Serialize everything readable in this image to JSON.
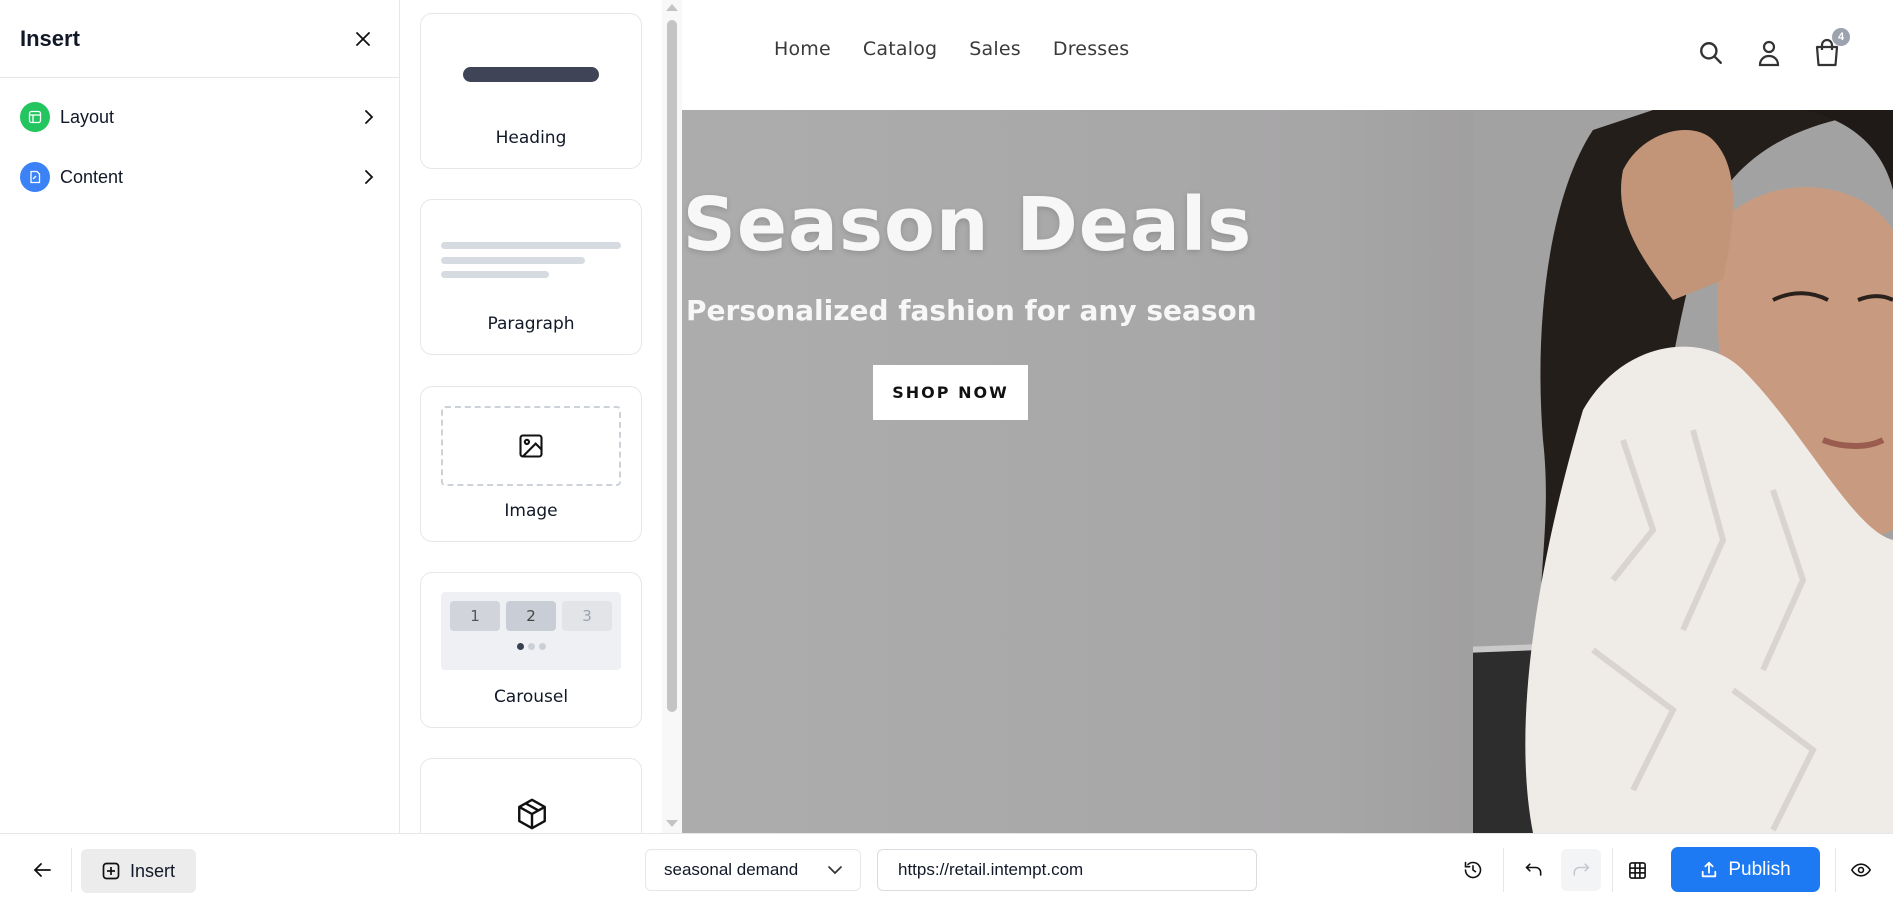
{
  "store": {
    "nav": [
      "Home",
      "Catalog",
      "Sales",
      "Dresses"
    ],
    "cart_count": "4",
    "hero": {
      "title": "op Season Deals",
      "subtitle": "Personalized fashion for any season",
      "cta_label": "SHOP NOW"
    }
  },
  "insert_panel": {
    "title": "Insert",
    "categories": [
      {
        "label": "Layout",
        "icon": "layout-icon",
        "color": "#22c55e"
      },
      {
        "label": "Content",
        "icon": "content-icon",
        "color": "#3b82f6"
      }
    ]
  },
  "widgets": {
    "heading": "Heading",
    "paragraph": "Paragraph",
    "image": "Image",
    "carousel": {
      "label": "Carousel",
      "slides": [
        "1",
        "2",
        "3"
      ]
    }
  },
  "toolbar": {
    "insert_label": "Insert",
    "segment_value": "seasonal demand",
    "url_value": "https://retail.intempt.com",
    "publish_label": "Publish"
  },
  "colors": {
    "accent": "#1d7af3",
    "layout_green": "#22c55e",
    "content_blue": "#3b82f6"
  }
}
